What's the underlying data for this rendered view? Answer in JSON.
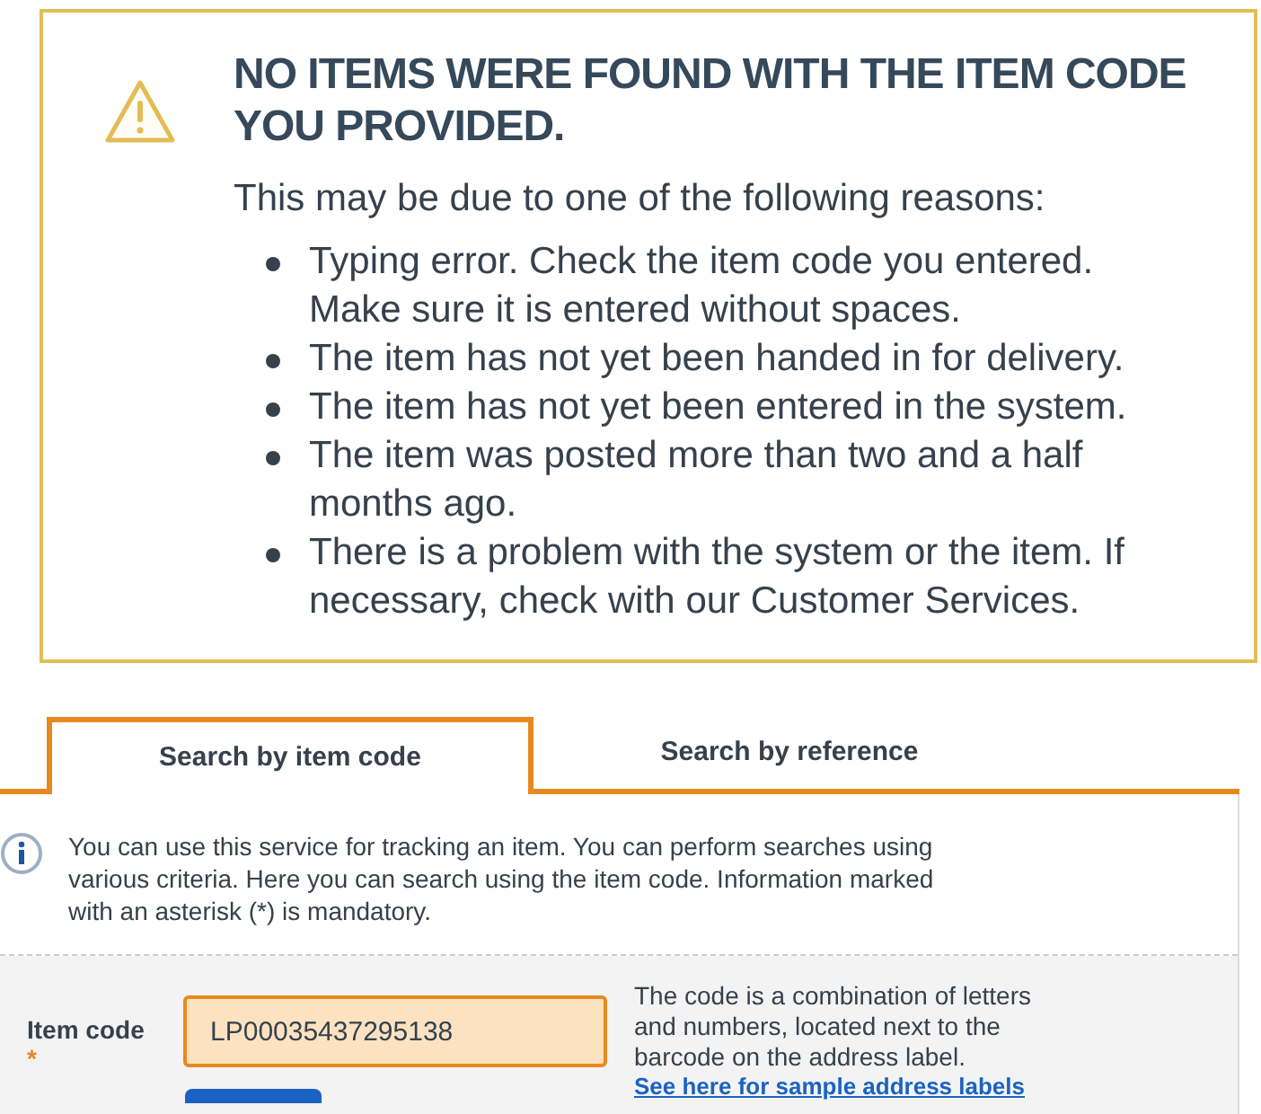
{
  "alert": {
    "title": "NO ITEMS WERE FOUND WITH THE ITEM CODE YOU PROVIDED.",
    "intro": "This may be due to one of the following reasons:",
    "reasons": [
      "Typing error. Check the item code you entered. Make sure it is entered without spaces.",
      "The item has not yet been handed in for delivery.",
      "The item has not yet been entered in the system.",
      "The item was posted more than two and a half months ago.",
      "There is a problem with the system or the item. If necessary, check with our Customer Services."
    ]
  },
  "tabs": [
    {
      "label": "Search by item code",
      "selected": true
    },
    {
      "label": "Search by reference",
      "selected": false
    }
  ],
  "info": "You can use this service for tracking an item. You can perform searches using various criteria. Here you can search using the item code. Information marked with an asterisk (*) is mandatory.",
  "form": {
    "label": "Item code",
    "required_mark": "*",
    "value": "LP00035437295138",
    "help": "The code is a combination of letters and numbers, located next to the barcode on the address label.",
    "link": "See here for sample address labels"
  }
}
